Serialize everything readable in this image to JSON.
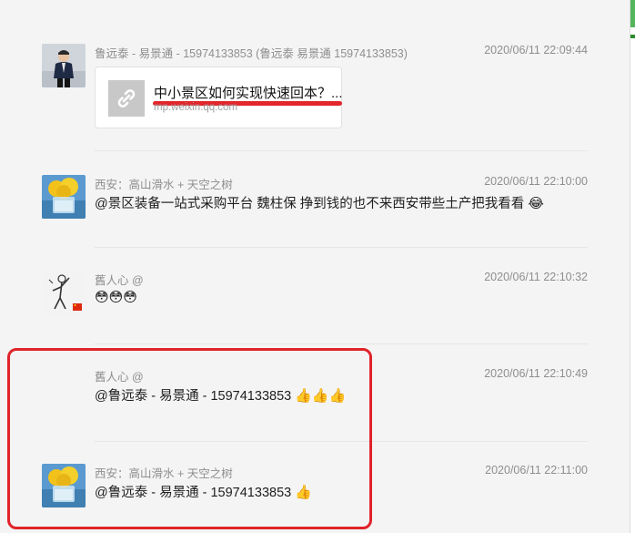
{
  "messages": [
    {
      "sender": "鲁远泰 - 易景通 - 15974133853 (鲁远泰  易景通  15974133853)",
      "time": "2020/06/11 22:09:44",
      "link": {
        "title": "中小景区如何实现快速回本？...",
        "domain": "mp.weixin.qq.com"
      }
    },
    {
      "sender": "西安：高山滑水 + 天空之树",
      "time": "2020/06/11 22:10:00",
      "text": "@景区装备一站式采购平台 魏柱保 挣到钱的也不来西安带些土产把我看看",
      "emoji": "😂"
    },
    {
      "sender": "舊人心 @",
      "time": "2020/06/11 22:10:32",
      "text": "",
      "emoji": "😳😳😳"
    },
    {
      "sender": "舊人心 @",
      "time": "2020/06/11 22:10:49",
      "text": "@鲁远泰 - 易景通 - 15974133853",
      "emoji": "👍👍👍"
    },
    {
      "sender": "西安：高山滑水 + 天空之树",
      "time": "2020/06/11 22:11:00",
      "text": "@鲁远泰 - 易景通 - 15974133853",
      "emoji": "👍"
    }
  ],
  "colors": {
    "highlight": "#e0232a",
    "background": "#f4f4f4"
  }
}
